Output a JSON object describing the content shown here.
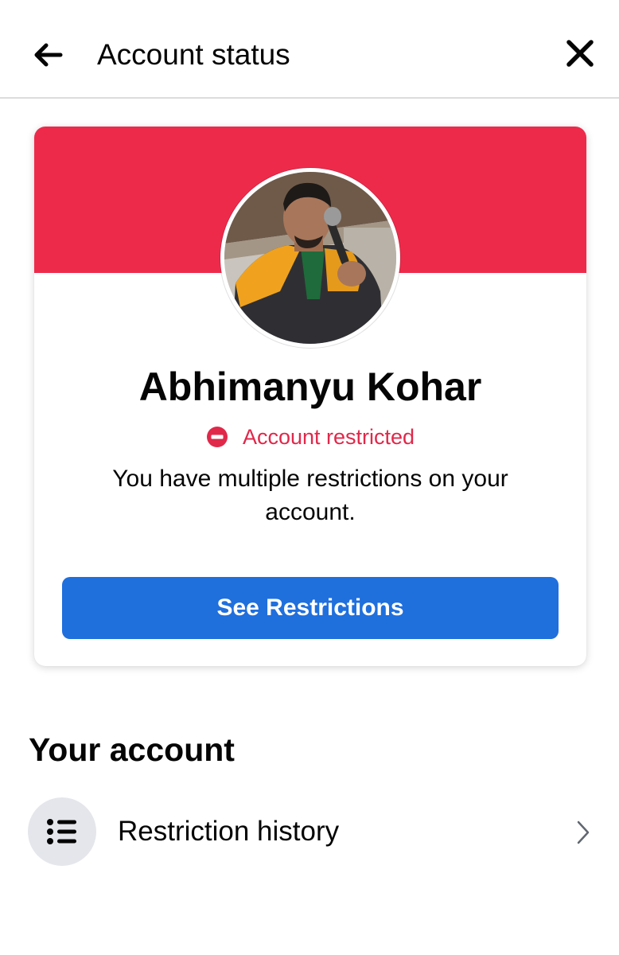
{
  "header": {
    "title": "Account status",
    "back_icon": "arrow-left-icon",
    "close_icon": "close-icon"
  },
  "card": {
    "banner_color": "#EE2A4B",
    "user_name": "Abhimanyu Kohar",
    "status": {
      "text": "Account restricted",
      "icon": "restricted-icon",
      "color": "#E0284A"
    },
    "description": "You have multiple restrictions on your account.",
    "button": {
      "label": "See Restrictions",
      "color": "#1F6FDD"
    }
  },
  "your_account": {
    "title": "Your account",
    "items": [
      {
        "label": "Restriction history",
        "icon": "list-icon",
        "trailing_icon": "chevron-right-icon"
      }
    ]
  }
}
